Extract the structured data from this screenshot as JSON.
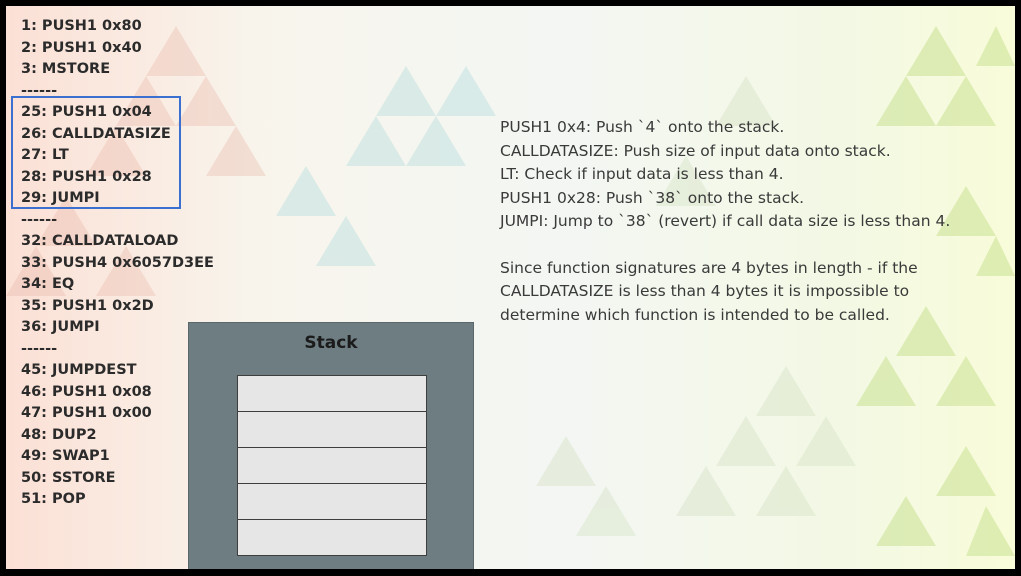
{
  "code": {
    "lines": [
      "1: PUSH1 0x80",
      "2: PUSH1 0x40",
      "3: MSTORE",
      "------",
      "25: PUSH1 0x04",
      "26: CALLDATASIZE",
      "27: LT",
      "28: PUSH1 0x28",
      "29: JUMPI",
      "------",
      "32: CALLDATALOAD",
      "33: PUSH4 0x6057D3EE",
      "34: EQ",
      "35: PUSH1 0x2D",
      "36: JUMPI",
      "------",
      "45: JUMPDEST",
      "46: PUSH1 0x08",
      "47: PUSH1 0x00",
      "48: DUP2",
      "49: SWAP1",
      "50: SSTORE",
      "51: POP"
    ],
    "highlighted_range": [
      "25: PUSH1 0x04",
      "29: JUMPI"
    ]
  },
  "explanation": {
    "lines": [
      "PUSH1 0x4: Push `4` onto the stack.",
      "CALLDATASIZE: Push size of input data onto stack.",
      "LT: Check if input data is less than 4.",
      "PUSH1 0x28: Push `38` onto the stack.",
      "JUMPI: Jump to `38` (revert) if call data size is less than 4."
    ],
    "paragraph": [
      "Since function signatures are 4 bytes in length - if the",
      "CALLDATASIZE is less than 4 bytes it is impossible to",
      "determine which function is intended to be called."
    ]
  },
  "stack": {
    "title": "Stack",
    "slot_count": 5
  },
  "colors": {
    "highlight_border": "#3b6fd0",
    "stack_panel": "#6d7d82",
    "stack_slot": "#e6e6e6"
  }
}
